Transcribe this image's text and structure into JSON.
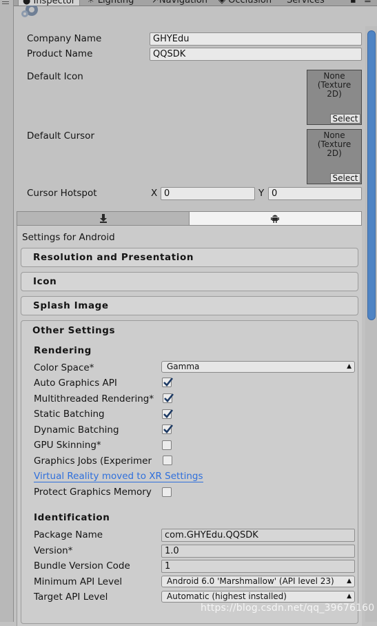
{
  "tabs": [
    {
      "label": "Inspector",
      "icon": "info-icon",
      "active": true
    },
    {
      "label": "Lighting",
      "icon": "lighting-icon"
    },
    {
      "label": "Navigation",
      "icon": "navigation-icon"
    },
    {
      "label": "Occlusion",
      "icon": "occlusion-icon"
    },
    {
      "label": "Services"
    }
  ],
  "player": {
    "company_label": "Company Name",
    "company_value": "GHYEdu",
    "product_label": "Product Name",
    "product_value": "QQSDK",
    "default_icon_label": "Default Icon",
    "default_cursor_label": "Default Cursor",
    "texture_none": "None\n(Texture\n2D)",
    "select_label": "Select",
    "cursor_hotspot_label": "Cursor Hotspot",
    "x_label": "X",
    "x_value": "0",
    "y_label": "Y",
    "y_value": "0"
  },
  "platform": {
    "settings_title": "Settings for Android",
    "standalone_icon": "download-icon",
    "android_icon": "android-icon"
  },
  "sections": {
    "resolution": "Resolution and Presentation",
    "icon": "Icon",
    "splash": "Splash Image",
    "other": "Other Settings"
  },
  "rendering": {
    "heading": "Rendering",
    "color_space_label": "Color Space*",
    "color_space_value": "Gamma",
    "auto_graphics_label": "Auto Graphics API",
    "auto_graphics_checked": true,
    "multithreaded_label": "Multithreaded Rendering*",
    "multithreaded_checked": true,
    "static_batching_label": "Static Batching",
    "static_batching_checked": true,
    "dynamic_batching_label": "Dynamic Batching",
    "dynamic_batching_checked": true,
    "gpu_skinning_label": "GPU Skinning*",
    "gpu_skinning_checked": false,
    "graphics_jobs_label": "Graphics Jobs (Experimer",
    "graphics_jobs_checked": false,
    "vr_link": "Virtual Reality moved to XR Settings",
    "protect_memory_label": "Protect Graphics Memory",
    "protect_memory_checked": false
  },
  "identification": {
    "heading": "Identification",
    "package_label": "Package Name",
    "package_value": "com.GHYEdu.QQSDK",
    "version_label": "Version*",
    "version_value": "1.0",
    "bundle_label": "Bundle Version Code",
    "bundle_value": "1",
    "min_api_label": "Minimum API Level",
    "min_api_value": "Android 6.0 'Marshmallow' (API level 23)",
    "target_api_label": "Target API Level",
    "target_api_value": "Automatic (highest installed)"
  },
  "watermark": "https://blog.csdn.net/qq_39676160",
  "colors": {
    "link": "#2e6fdc",
    "scrollbar_thumb": "#4f84c4",
    "panel_bg": "#c2c2c2"
  }
}
